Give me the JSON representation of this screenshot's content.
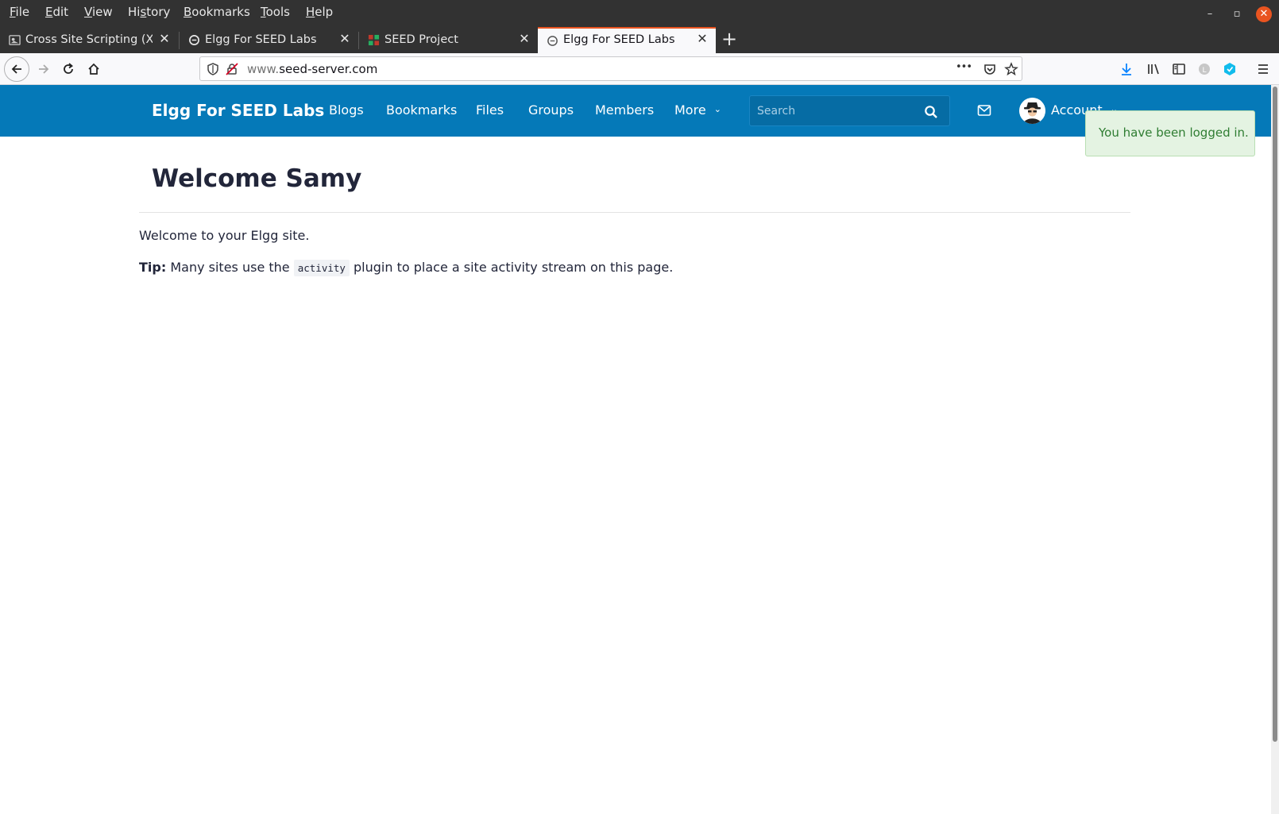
{
  "menubar": {
    "items": [
      "File",
      "Edit",
      "View",
      "History",
      "Bookmarks",
      "Tools",
      "Help"
    ],
    "underline": [
      "F",
      "E",
      "V",
      "s",
      "B",
      "T",
      "H"
    ]
  },
  "window_controls": {
    "minimize": "–",
    "restore": "▫",
    "close": "✕"
  },
  "tabs": [
    {
      "label": "Cross Site Scripting (XSS",
      "close": "✕"
    },
    {
      "label": "Elgg For SEED Labs",
      "close": "✕"
    },
    {
      "label": "SEED Project",
      "close": "✕"
    },
    {
      "label": "Elgg For SEED Labs",
      "close": "✕",
      "active": true
    }
  ],
  "new_tab": "+",
  "navbar": {
    "url_prefix": "www.",
    "url_domain": "seed-server.com",
    "more_actions": "•••"
  },
  "site": {
    "title": "Elgg For SEED Labs",
    "nav": [
      "Blogs",
      "Bookmarks",
      "Files",
      "Groups",
      "Members",
      "More"
    ],
    "more_chevron": "⌄",
    "search_placeholder": "Search",
    "account_label": "Account",
    "account_chevron": "⌄"
  },
  "flash": {
    "message": "You have been logged in."
  },
  "main": {
    "heading": "Welcome Samy",
    "intro": "Welcome to your Elgg site.",
    "tip_label": "Tip:",
    "tip_before": " Many sites use the ",
    "tip_code": "activity",
    "tip_after": " plugin to place a site activity stream on this page."
  },
  "colors": {
    "header": "#0579b8",
    "flash_bg": "#e4f3e2",
    "flash_text": "#2f7d32",
    "tab_accent": "#e95420"
  }
}
